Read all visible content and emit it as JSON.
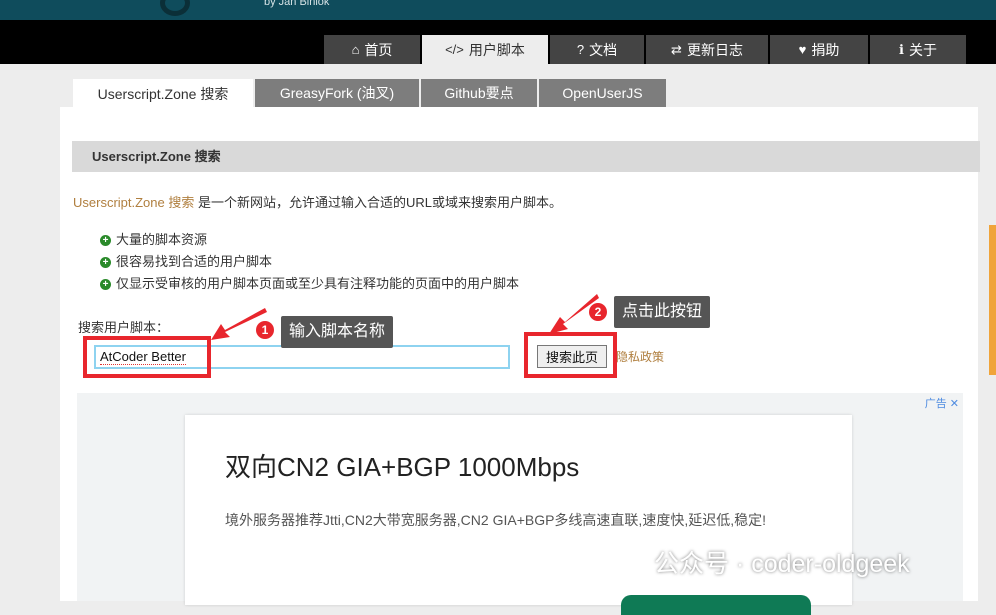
{
  "header": {
    "byline": "by Jan Biniok"
  },
  "nav": [
    {
      "icon": "⌂",
      "label": "首页"
    },
    {
      "icon": "</>",
      "label": "用户脚本"
    },
    {
      "icon": "?",
      "label": "文档"
    },
    {
      "icon": "⇄",
      "label": "更新日志"
    },
    {
      "icon": "♥",
      "label": "捐助"
    },
    {
      "icon": "ℹ",
      "label": "关于"
    }
  ],
  "tabs": [
    "Userscript.Zone 搜索",
    "GreasyFork (油叉)",
    "Github要点",
    "OpenUserJS"
  ],
  "section": {
    "heading": "Userscript.Zone 搜索",
    "intro_link": "Userscript.Zone 搜索",
    "intro_text": " 是一个新网站，允许通过输入合适的URL或域来搜索用户脚本。",
    "bullets": [
      "大量的脚本资源",
      "很容易找到合适的用户脚本",
      "仅显示受审核的用户脚本页面或至少具有注释功能的页面中的用户脚本"
    ],
    "search_label": "搜索用户脚本：",
    "search_value": "AtCoder Better",
    "search_button": "搜索此页",
    "privacy_link": "隐私政策"
  },
  "annotations": [
    {
      "number": "1",
      "text": "输入脚本名称"
    },
    {
      "number": "2",
      "text": "点击此按钮"
    }
  ],
  "ad": {
    "badge": "广告 ✕",
    "title": "双向CN2 GIA+BGP 1000Mbps",
    "text": "境外服务器推荐Jtti,CN2大带宽服务器,CN2 GIA+BGP多线高速直联,速度快,延迟低,稳定!"
  },
  "watermark": "公众号 · coder-oldgeek",
  "colors": {
    "annotation_red": "#e8262d",
    "nav_bg": "#444444",
    "header_teal": "#0f4c5c"
  }
}
